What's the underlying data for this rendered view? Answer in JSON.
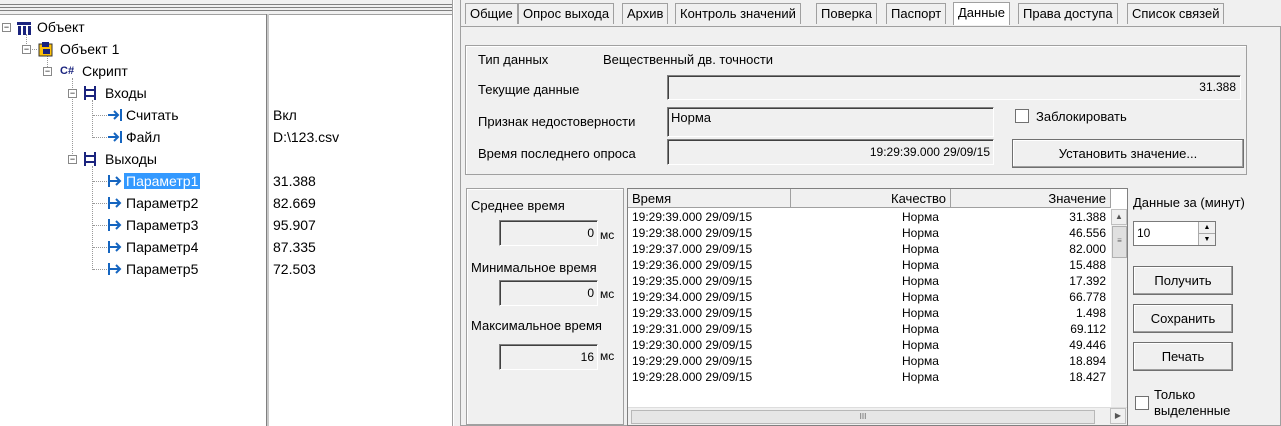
{
  "tree": {
    "root": {
      "label": "Объект"
    },
    "object1": {
      "label": "Объект 1"
    },
    "script": {
      "label": "Скрипт",
      "icon_text": "C#"
    },
    "inputs": {
      "label": "Входы"
    },
    "input_items": [
      {
        "label": "Считать",
        "value": "Вкл"
      },
      {
        "label": "Файл",
        "value": "D:\\123.csv"
      }
    ],
    "outputs": {
      "label": "Выходы"
    },
    "output_items": [
      {
        "label": "Параметр1",
        "value": "31.388"
      },
      {
        "label": "Параметр2",
        "value": "82.669"
      },
      {
        "label": "Параметр3",
        "value": "95.907"
      },
      {
        "label": "Параметр4",
        "value": "87.335"
      },
      {
        "label": "Параметр5",
        "value": "72.503"
      }
    ]
  },
  "tabs": [
    "Общие",
    "Опрос выхода",
    "Архив",
    "Контроль значений",
    "Поверка",
    "Паспорт",
    "Данные",
    "Права доступа",
    "Список связей"
  ],
  "active_tab": "Данные",
  "data_panel": {
    "type_label": "Тип данных",
    "type_value": "Вещественный дв. точности",
    "current_label": "Текущие данные",
    "current_value": "31.388",
    "validity_label": "Признак недостоверности",
    "validity_value": "Норма",
    "lock_label": "Заблокировать",
    "last_poll_label": "Время последнего опроса",
    "last_poll_value": "19:29:39.000 29/09/15",
    "set_value_button": "Установить значение..."
  },
  "stats": {
    "avg_label": "Среднее время",
    "avg_value": "0",
    "min_label": "Минимальное время",
    "min_value": "0",
    "max_label": "Максимальное время",
    "max_value": "16",
    "unit": "мс"
  },
  "grid": {
    "columns": [
      "Время",
      "Качество",
      "Значение"
    ],
    "rows": [
      [
        "19:29:39.000 29/09/15",
        "Норма",
        "31.388"
      ],
      [
        "19:29:38.000 29/09/15",
        "Норма",
        "46.556"
      ],
      [
        "19:29:37.000 29/09/15",
        "Норма",
        "82.000"
      ],
      [
        "19:29:36.000 29/09/15",
        "Норма",
        "15.488"
      ],
      [
        "19:29:35.000 29/09/15",
        "Норма",
        "17.392"
      ],
      [
        "19:29:34.000 29/09/15",
        "Норма",
        "66.778"
      ],
      [
        "19:29:33.000 29/09/15",
        "Норма",
        "1.498"
      ],
      [
        "19:29:31.000 29/09/15",
        "Норма",
        "69.112"
      ],
      [
        "19:29:30.000 29/09/15",
        "Норма",
        "49.446"
      ],
      [
        "19:29:29.000 29/09/15",
        "Норма",
        "18.894"
      ],
      [
        "19:29:28.000 29/09/15",
        "Норма",
        "18.427"
      ]
    ]
  },
  "controls": {
    "period_label": "Данные за (минут)",
    "period_value": "10",
    "get_button": "Получить",
    "save_button": "Сохранить",
    "print_button": "Печать",
    "only_selected_line1": "Только",
    "only_selected_line2": "выделенные"
  }
}
